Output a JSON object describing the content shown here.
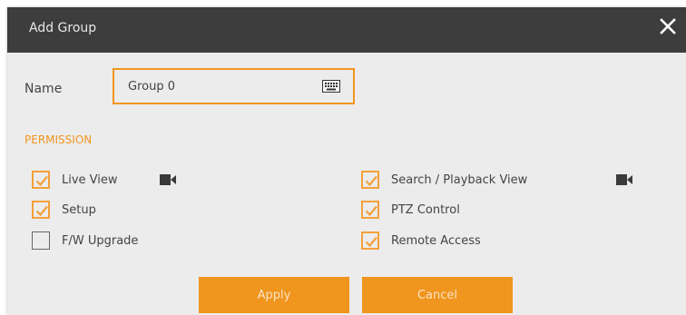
{
  "dialog": {
    "title": "Add Group",
    "close_icon": "close-icon"
  },
  "name": {
    "label": "Name",
    "value": "Group 0",
    "keyboard_icon": "keyboard-icon"
  },
  "permission": {
    "section_title": "PERMISSION",
    "items": [
      {
        "label": "Live View",
        "checked": true,
        "icon": "camera-icon"
      },
      {
        "label": "Setup",
        "checked": true
      },
      {
        "label": "F/W Upgrade",
        "checked": false
      },
      {
        "label": "Search / Playback View",
        "checked": true,
        "icon": "camera-icon"
      },
      {
        "label": "PTZ Control",
        "checked": true
      },
      {
        "label": "Remote Access",
        "checked": true
      }
    ]
  },
  "buttons": {
    "apply": "Apply",
    "cancel": "Cancel"
  },
  "colors": {
    "accent": "#f0951e",
    "titlebar": "#3d3d3d",
    "background": "#ececec"
  }
}
